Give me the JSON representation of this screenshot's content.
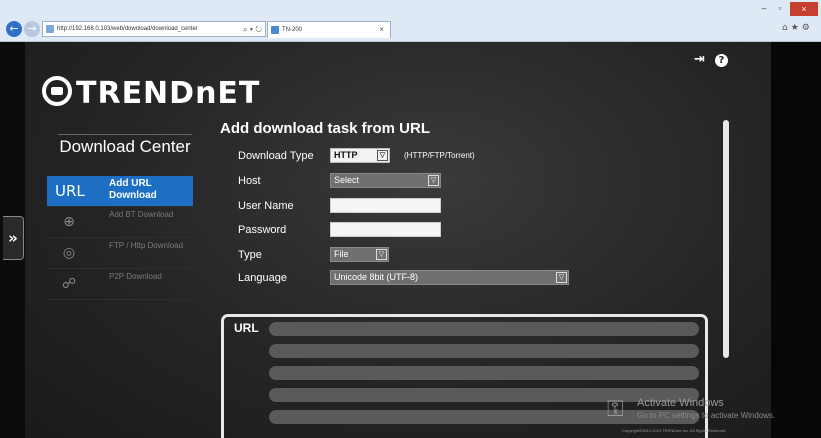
{
  "browser": {
    "address": "http://192.168.0.103/web/download/download_center",
    "address_tools": "⌕ ▾ ↻",
    "tab_title": "TN-200",
    "tab_close": "×",
    "nav_back": "←",
    "nav_forward": "→",
    "window_min": "–",
    "window_max": "▫",
    "window_close": "×",
    "toolbar_icons": "⌂★⚙"
  },
  "app": {
    "logo_text": "TRENDnET",
    "top_icons": {
      "logout": "⇥",
      "help": "?"
    },
    "expand_label": "»",
    "download_center_title": "Download Center",
    "menu": [
      {
        "icon": "URL",
        "label": "Add URL Download",
        "active": true
      },
      {
        "icon": "⊕",
        "label": "Add BT Download",
        "active": false
      },
      {
        "icon": "◎",
        "label": "FTP / Http Download",
        "active": false
      },
      {
        "icon": "☍",
        "label": "P2P Download",
        "active": false
      }
    ]
  },
  "form": {
    "title": "Add download task from URL",
    "download_type": {
      "label": "Download Type",
      "value": "HTTP",
      "hint": "(HTTP/FTP/Torrent)"
    },
    "host": {
      "label": "Host",
      "value": "Select"
    },
    "username": {
      "label": "User Name",
      "value": ""
    },
    "password": {
      "label": "Password",
      "value": ""
    },
    "type": {
      "label": "Type",
      "value": "File"
    },
    "language": {
      "label": "Language",
      "value": "Unicode 8bit (UTF-8)"
    },
    "url_label": "URL",
    "dropdown_arrow": "▽"
  },
  "watermark": {
    "title": "Activate Windows",
    "subtitle": "Go to PC settings to activate Windows.",
    "icon": "⚿"
  },
  "copyright": "Copyright©2012-2013 TRENDnet Inc. All Rights Reserved.",
  "colors": {
    "accent": "#1d6fc4",
    "background": "#252525"
  }
}
